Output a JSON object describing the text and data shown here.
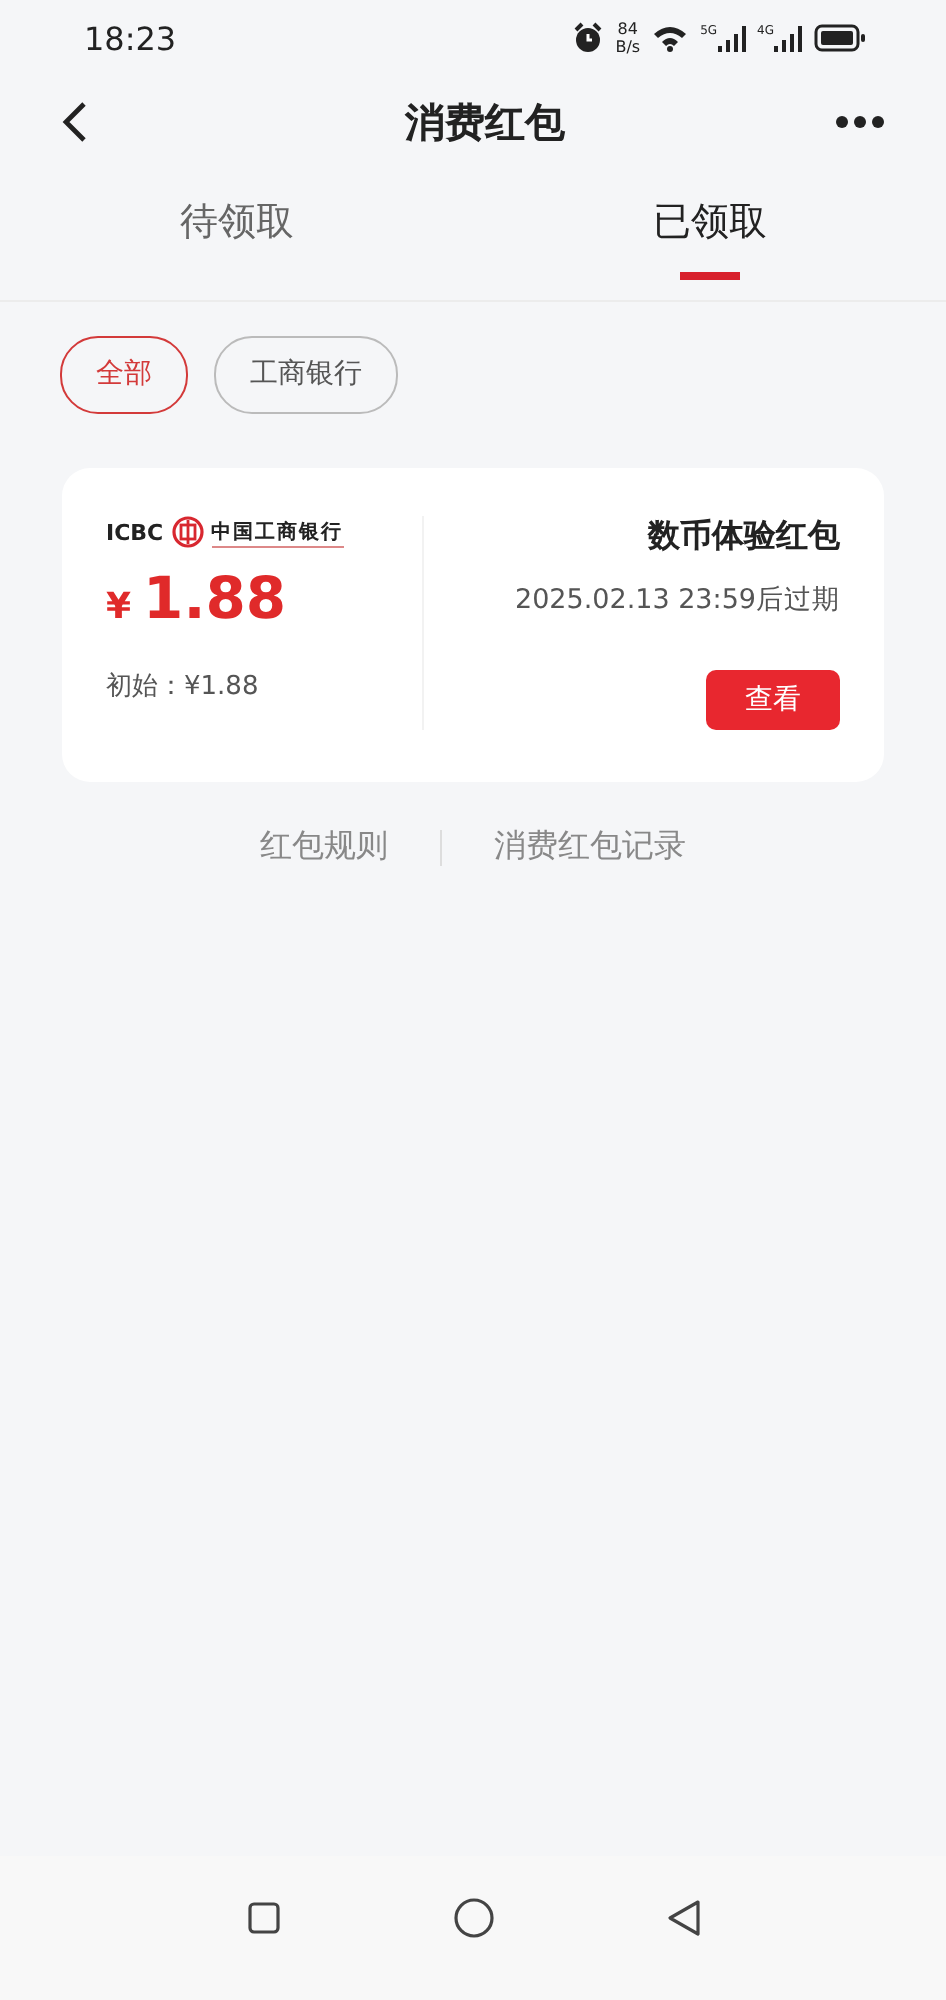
{
  "status_bar": {
    "time": "18:23",
    "net_speed": "84",
    "net_unit": "B/s",
    "sim1": "5G",
    "sim2": "4G"
  },
  "header": {
    "title": "消费红包"
  },
  "tabs": [
    {
      "label": "待领取",
      "selected": false
    },
    {
      "label": "已领取",
      "selected": true
    }
  ],
  "filters": [
    {
      "label": "全部",
      "selected": true
    },
    {
      "label": "工商银行",
      "selected": false
    }
  ],
  "coupons": [
    {
      "bank_code": "ICBC",
      "bank_name": "中国工商银行",
      "currency": "¥",
      "amount": "1.88",
      "initial": "初始：¥1.88",
      "title": "数币体验红包",
      "expiry": "2025.02.13 23:59后过期",
      "action": "查看"
    }
  ],
  "links": [
    "红包规则",
    "消费红包记录"
  ]
}
